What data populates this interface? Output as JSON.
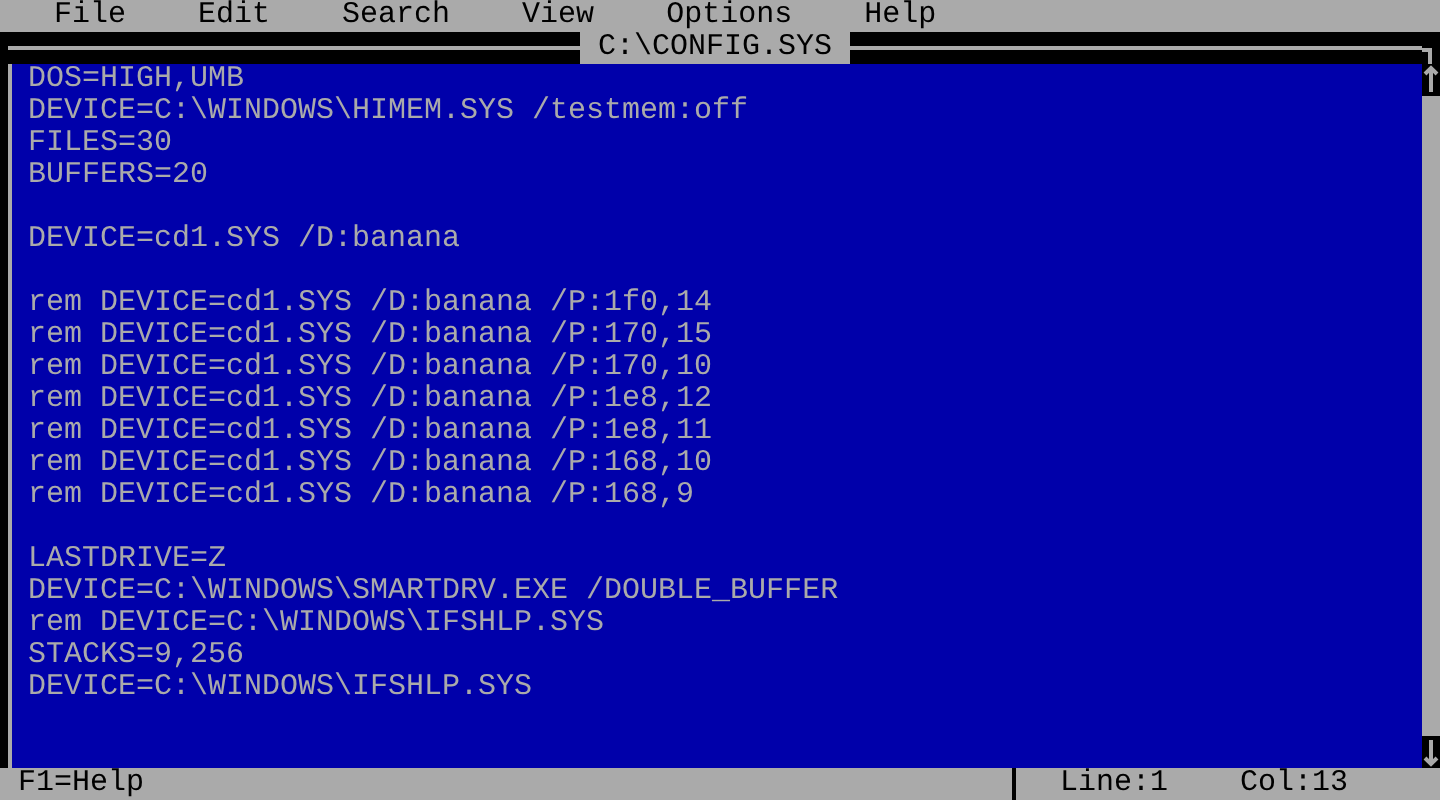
{
  "menu": [
    "File",
    "Edit",
    "Search",
    "View",
    "Options",
    "Help"
  ],
  "window": {
    "title": "C:\\CONFIG.SYS"
  },
  "editor": {
    "blocks": [
      [
        "DOS=HIGH,UMB",
        "DEVICE=C:\\WINDOWS\\HIMEM.SYS /testmem:off",
        "FILES=30",
        "BUFFERS=20"
      ],
      [
        "DEVICE=cd1.SYS /D:banana"
      ],
      [
        "rem DEVICE=cd1.SYS /D:banana /P:1f0,14",
        "rem DEVICE=cd1.SYS /D:banana /P:170,15",
        "rem DEVICE=cd1.SYS /D:banana /P:170,10",
        "rem DEVICE=cd1.SYS /D:banana /P:1e8,12",
        "rem DEVICE=cd1.SYS /D:banana /P:1e8,11",
        "rem DEVICE=cd1.SYS /D:banana /P:168,10",
        "rem DEVICE=cd1.SYS /D:banana /P:168,9"
      ],
      [
        "LASTDRIVE=Z",
        "DEVICE=C:\\WINDOWS\\SMARTDRV.EXE /DOUBLE_BUFFER",
        "rem DEVICE=C:\\WINDOWS\\IFSHLP.SYS",
        "STACKS=9,256",
        "DEVICE=C:\\WINDOWS\\IFSHLP.SYS"
      ]
    ]
  },
  "status_bar": {
    "hint": "F1=Help",
    "line": "Line:1",
    "column": "Col:13"
  }
}
